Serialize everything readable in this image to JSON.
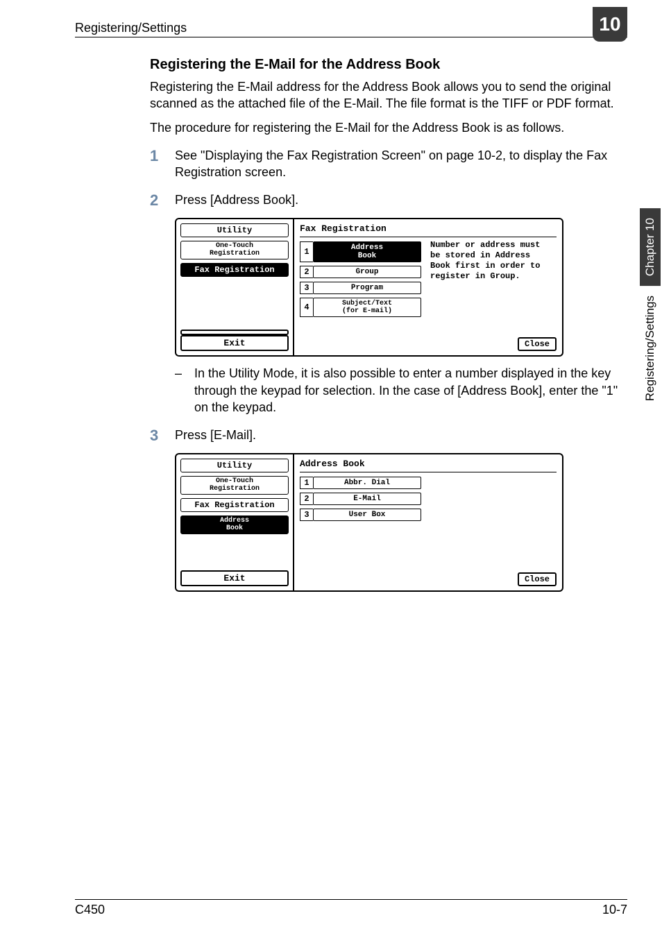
{
  "header": {
    "breadcrumb": "Registering/Settings",
    "chapter_num": "10"
  },
  "section": {
    "title": "Registering the E-Mail for the Address Book",
    "intro1": "Registering the E-Mail address for the Address Book allows you to send the original scanned as the attached file of the E-Mail. The file format is the TIFF or PDF format.",
    "intro2": "The procedure for registering the E-Mail for the Address Book is as follows."
  },
  "steps": {
    "s1": {
      "num": "1",
      "text": "See \"Displaying the Fax Registration Screen\" on page 10-2, to display the Fax Registration screen."
    },
    "s2": {
      "num": "2",
      "text": "Press [Address Book]."
    },
    "s2_note": "In the Utility Mode, it is also possible to enter a number displayed in the key through the keypad for selection. In the case of [Address Book], enter the \"1\" on the keypad.",
    "s3": {
      "num": "3",
      "text": "Press [E-Mail]."
    }
  },
  "screen1": {
    "sidebar": {
      "utility": "Utility",
      "onetouch": "One-Touch\nRegistration",
      "faxreg": "Fax Registration",
      "exit": "Exit"
    },
    "main": {
      "title": "Fax Registration",
      "b1": "Address\nBook",
      "b2": "Group",
      "b3": "Program",
      "b4": "Subject/Text\n(for E-mail)",
      "hint": "Number or address must be stored in Address Book first in order to register in Group.",
      "close": "Close"
    }
  },
  "screen2": {
    "sidebar": {
      "utility": "Utility",
      "onetouch": "One-Touch\nRegistration",
      "faxreg": "Fax Registration",
      "addrbook": "Address\nBook",
      "exit": "Exit"
    },
    "main": {
      "title": "Address Book",
      "b1": "Abbr. Dial",
      "b2": "E-Mail",
      "b3": "User Box",
      "close": "Close"
    }
  },
  "sidetab": {
    "chapter": "Chapter 10",
    "section": "Registering/Settings"
  },
  "footer": {
    "left": "C450",
    "right": "10-7"
  }
}
